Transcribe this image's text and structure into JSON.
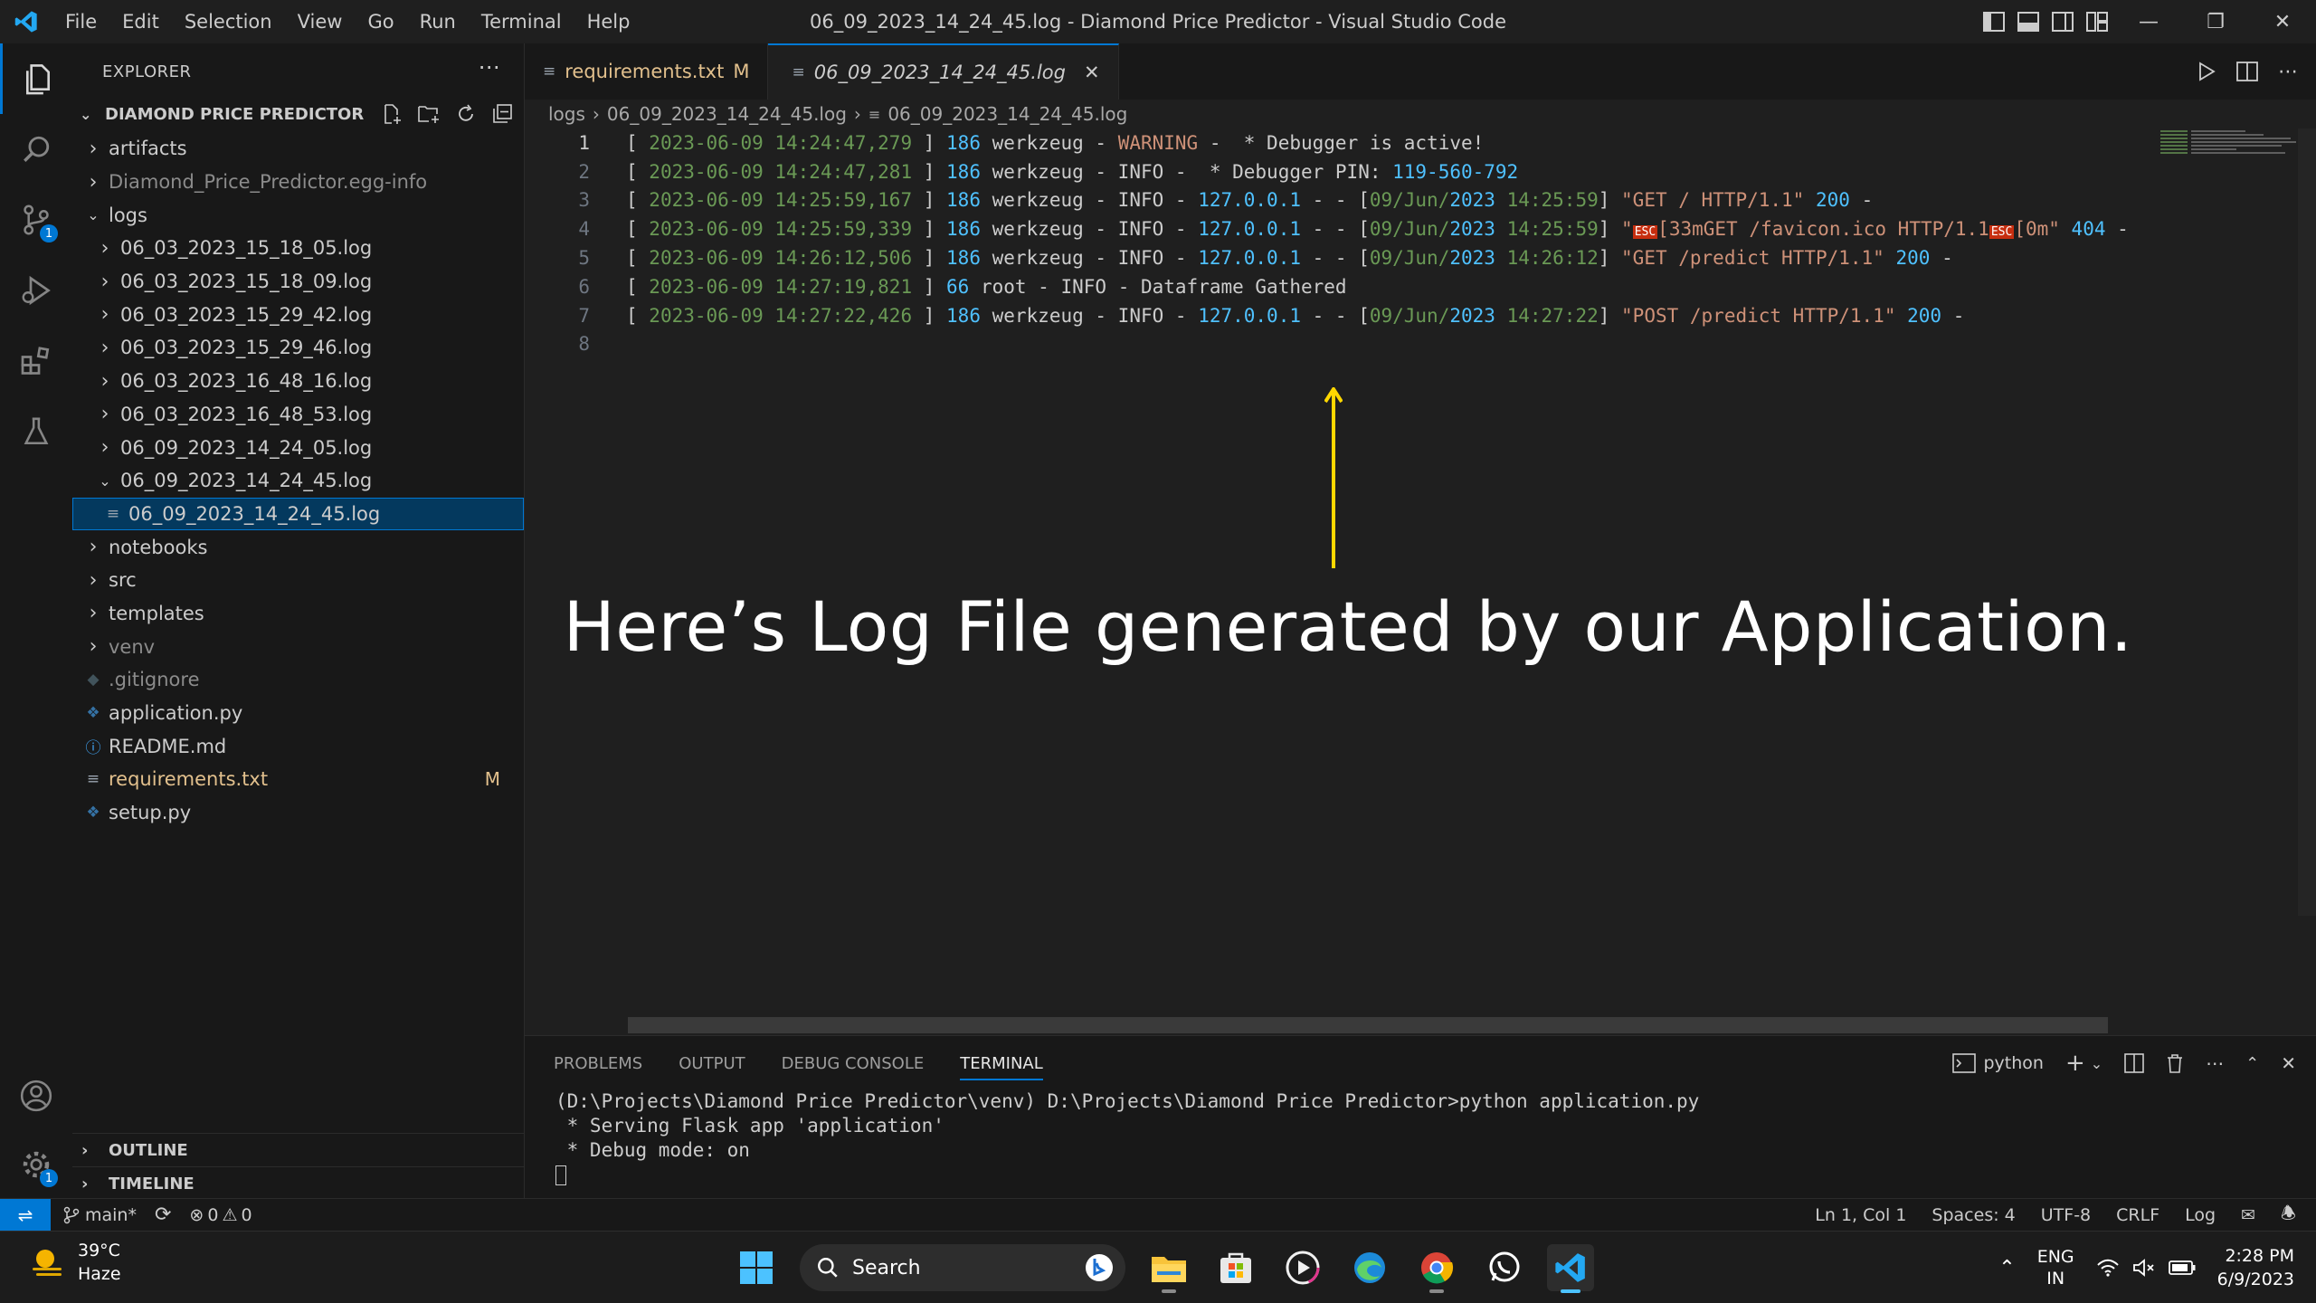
{
  "window": {
    "title": "06_09_2023_14_24_45.log - Diamond Price Predictor - Visual Studio Code",
    "menu": [
      "File",
      "Edit",
      "Selection",
      "View",
      "Go",
      "Run",
      "Terminal",
      "Help"
    ]
  },
  "activity_bar": {
    "source_control_badge": "1",
    "settings_badge": "1"
  },
  "explorer": {
    "header": "EXPLORER",
    "root": "DIAMOND PRICE PREDICTOR",
    "tree": [
      {
        "label": "artifacts",
        "kind": "folder",
        "depth": 1,
        "open": false
      },
      {
        "label": "Diamond_Price_Predictor.egg-info",
        "kind": "folder",
        "depth": 1,
        "open": false,
        "dim": true
      },
      {
        "label": "logs",
        "kind": "folder",
        "depth": 1,
        "open": true
      },
      {
        "label": "06_03_2023_15_18_05.log",
        "kind": "folder",
        "depth": 2,
        "open": false
      },
      {
        "label": "06_03_2023_15_18_09.log",
        "kind": "folder",
        "depth": 2,
        "open": false
      },
      {
        "label": "06_03_2023_15_29_42.log",
        "kind": "folder",
        "depth": 2,
        "open": false
      },
      {
        "label": "06_03_2023_15_29_46.log",
        "kind": "folder",
        "depth": 2,
        "open": false
      },
      {
        "label": "06_03_2023_16_48_16.log",
        "kind": "folder",
        "depth": 2,
        "open": false
      },
      {
        "label": "06_03_2023_16_48_53.log",
        "kind": "folder",
        "depth": 2,
        "open": false
      },
      {
        "label": "06_09_2023_14_24_05.log",
        "kind": "folder",
        "depth": 2,
        "open": false
      },
      {
        "label": "06_09_2023_14_24_45.log",
        "kind": "folder",
        "depth": 2,
        "open": true
      },
      {
        "label": "06_09_2023_14_24_45.log",
        "kind": "file",
        "icon": "lines",
        "depth": 3,
        "selected": true
      },
      {
        "label": "notebooks",
        "kind": "folder",
        "depth": 1,
        "open": false
      },
      {
        "label": "src",
        "kind": "folder",
        "depth": 1,
        "open": false
      },
      {
        "label": "templates",
        "kind": "folder",
        "depth": 1,
        "open": false
      },
      {
        "label": "venv",
        "kind": "folder",
        "depth": 1,
        "open": false,
        "dim": true
      },
      {
        "label": ".gitignore",
        "kind": "file",
        "icon": "git",
        "depth": 1,
        "dim": true
      },
      {
        "label": "application.py",
        "kind": "file",
        "icon": "python",
        "depth": 1
      },
      {
        "label": "README.md",
        "kind": "file",
        "icon": "info",
        "depth": 1
      },
      {
        "label": "requirements.txt",
        "kind": "file",
        "icon": "lines",
        "depth": 1,
        "modified": true,
        "badge": "M"
      },
      {
        "label": "setup.py",
        "kind": "file",
        "icon": "python",
        "depth": 1
      }
    ],
    "outline_label": "OUTLINE",
    "timeline_label": "TIMELINE"
  },
  "tabs": [
    {
      "label": "requirements.txt",
      "mark": "M",
      "active": false
    },
    {
      "label": "06_09_2023_14_24_45.log",
      "mark": "✕",
      "active": true
    }
  ],
  "breadcrumb": [
    "logs",
    "06_09_2023_14_24_45.log",
    "06_09_2023_14_24_45.log"
  ],
  "code_lines": [
    [
      [
        "[ ",
        "c-info"
      ],
      [
        "2023-06-09 14:24:47,279",
        "c-ts"
      ],
      [
        " ] ",
        "c-info"
      ],
      [
        "186",
        "c-num"
      ],
      [
        " werkzeug - ",
        "c-info"
      ],
      [
        "WARNING",
        "c-warn"
      ],
      [
        " -  * Debugger is active!",
        "c-info"
      ]
    ],
    [
      [
        "[ ",
        "c-info"
      ],
      [
        "2023-06-09 14:24:47,281",
        "c-ts"
      ],
      [
        " ] ",
        "c-info"
      ],
      [
        "186",
        "c-num"
      ],
      [
        " werkzeug - INFO -  * Debugger PIN: ",
        "c-info"
      ],
      [
        "119-560-792",
        "c-num"
      ]
    ],
    [
      [
        "[ ",
        "c-info"
      ],
      [
        "2023-06-09 14:25:59,167",
        "c-ts"
      ],
      [
        " ] ",
        "c-info"
      ],
      [
        "186",
        "c-num"
      ],
      [
        " werkzeug - INFO - ",
        "c-info"
      ],
      [
        "127.0.0.1",
        "c-num"
      ],
      [
        " - - [",
        "c-info"
      ],
      [
        "09/Jun/",
        "c-ts"
      ],
      [
        "2023",
        "c-num"
      ],
      [
        " 14:25:59",
        "c-ts"
      ],
      [
        "] ",
        "c-info"
      ],
      [
        "\"GET / HTTP/1.1\"",
        "c-str"
      ],
      [
        " ",
        "c-info"
      ],
      [
        "200",
        "c-num"
      ],
      [
        " -",
        "c-info"
      ]
    ],
    [
      [
        "[ ",
        "c-info"
      ],
      [
        "2023-06-09 14:25:59,339",
        "c-ts"
      ],
      [
        " ] ",
        "c-info"
      ],
      [
        "186",
        "c-num"
      ],
      [
        " werkzeug - INFO - ",
        "c-info"
      ],
      [
        "127.0.0.1",
        "c-num"
      ],
      [
        " - - [",
        "c-info"
      ],
      [
        "09/Jun/",
        "c-ts"
      ],
      [
        "2023",
        "c-num"
      ],
      [
        " 14:25:59",
        "c-ts"
      ],
      [
        "] ",
        "c-info"
      ],
      [
        "\"",
        "c-str"
      ],
      [
        "ESC",
        "esc"
      ],
      [
        "[33mGET /favicon.ico HTTP/1.1",
        "c-str"
      ],
      [
        "ESC",
        "esc"
      ],
      [
        "[0m\"",
        "c-str"
      ],
      [
        " ",
        "c-info"
      ],
      [
        "404",
        "c-num"
      ],
      [
        " -",
        "c-info"
      ]
    ],
    [
      [
        "[ ",
        "c-info"
      ],
      [
        "2023-06-09 14:26:12,506",
        "c-ts"
      ],
      [
        " ] ",
        "c-info"
      ],
      [
        "186",
        "c-num"
      ],
      [
        " werkzeug - INFO - ",
        "c-info"
      ],
      [
        "127.0.0.1",
        "c-num"
      ],
      [
        " - - [",
        "c-info"
      ],
      [
        "09/Jun/",
        "c-ts"
      ],
      [
        "2023",
        "c-num"
      ],
      [
        " 14:26:12",
        "c-ts"
      ],
      [
        "] ",
        "c-info"
      ],
      [
        "\"GET /predict HTTP/1.1\"",
        "c-str"
      ],
      [
        " ",
        "c-info"
      ],
      [
        "200",
        "c-num"
      ],
      [
        " -",
        "c-info"
      ]
    ],
    [
      [
        "[ ",
        "c-info"
      ],
      [
        "2023-06-09 14:27:19,821",
        "c-ts"
      ],
      [
        " ] ",
        "c-info"
      ],
      [
        "66",
        "c-num"
      ],
      [
        " root - INFO - Dataframe Gathered",
        "c-info"
      ]
    ],
    [
      [
        "[ ",
        "c-info"
      ],
      [
        "2023-06-09 14:27:22,426",
        "c-ts"
      ],
      [
        " ] ",
        "c-info"
      ],
      [
        "186",
        "c-num"
      ],
      [
        " werkzeug - INFO - ",
        "c-info"
      ],
      [
        "127.0.0.1",
        "c-num"
      ],
      [
        " - - [",
        "c-info"
      ],
      [
        "09/Jun/",
        "c-ts"
      ],
      [
        "2023",
        "c-num"
      ],
      [
        " 14:27:22",
        "c-ts"
      ],
      [
        "] ",
        "c-info"
      ],
      [
        "\"POST /predict HTTP/1.1\"",
        "c-str"
      ],
      [
        " ",
        "c-info"
      ],
      [
        "200",
        "c-num"
      ],
      [
        " -",
        "c-info"
      ]
    ],
    []
  ],
  "annotation": {
    "text": "Here’s Log File generated by our Application.",
    "color": "#ffd700"
  },
  "panel": {
    "tabs": [
      "PROBLEMS",
      "OUTPUT",
      "DEBUG CONSOLE",
      "TERMINAL"
    ],
    "active_tab": "TERMINAL",
    "terminal_name": "python",
    "terminal_lines": [
      "(D:\\Projects\\Diamond Price Predictor\\venv) D:\\Projects\\Diamond Price Predictor>python application.py",
      " * Serving Flask app 'application'",
      " * Debug mode: on"
    ]
  },
  "status": {
    "branch": "main*",
    "errors": "0",
    "warnings": "0",
    "position": "Ln 1, Col 1",
    "spaces": "Spaces: 4",
    "encoding": "UTF-8",
    "eol": "CRLF",
    "language": "Log"
  },
  "taskbar": {
    "temperature": "39°C",
    "condition": "Haze",
    "search_label": "Search",
    "lang_top": "ENG",
    "lang_bottom": "IN",
    "time": "2:28 PM",
    "date": "6/9/2023"
  },
  "colors": {
    "accent": "#0078d4",
    "modified": "#e2c08d"
  }
}
